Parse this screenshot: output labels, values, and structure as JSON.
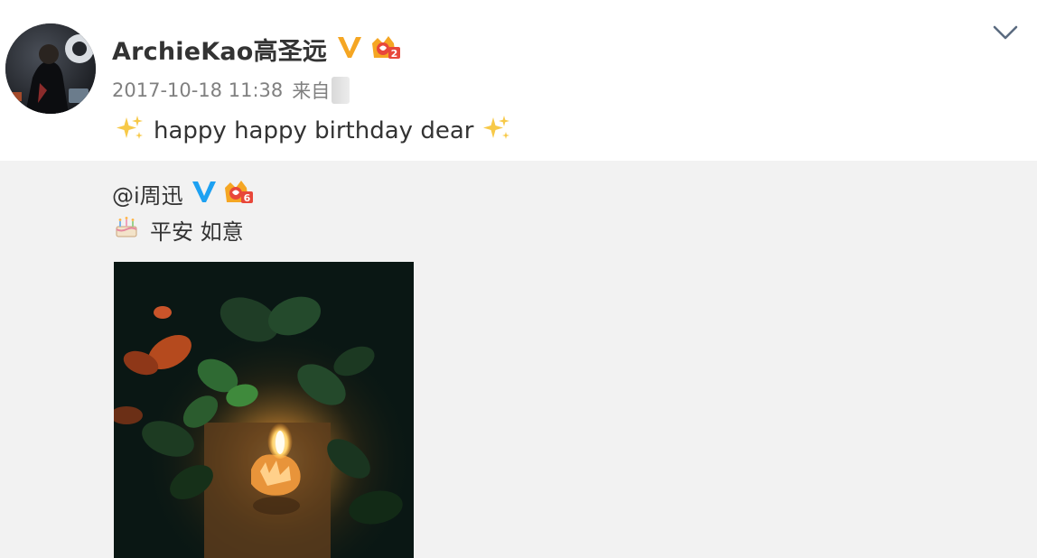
{
  "post": {
    "username": "ArchieKao高圣远",
    "timestamp": "2017-10-18 11:38",
    "source_prefix": "来自",
    "text": "happy happy birthday dear",
    "verified_icon": "verified-v-icon",
    "level_icon": "crown-level-icon",
    "level_number": "2",
    "sparkle_icon": "sparkles-icon",
    "menu_icon": "chevron-down-icon"
  },
  "repost": {
    "mention": "@i周迅",
    "text": "平安 如意",
    "verified_icon": "verified-v-icon",
    "level_icon": "crown-level-icon",
    "level_number": "6",
    "cake_icon": "birthday-cake-icon",
    "image_description": "photo-candle-plants"
  },
  "colors": {
    "text_primary": "#333333",
    "text_secondary": "#808080",
    "verified_gold": "#f5a623",
    "verified_blue": "#1da1f2",
    "repost_background": "#f2f2f2",
    "badge_red": "#e8473a"
  }
}
